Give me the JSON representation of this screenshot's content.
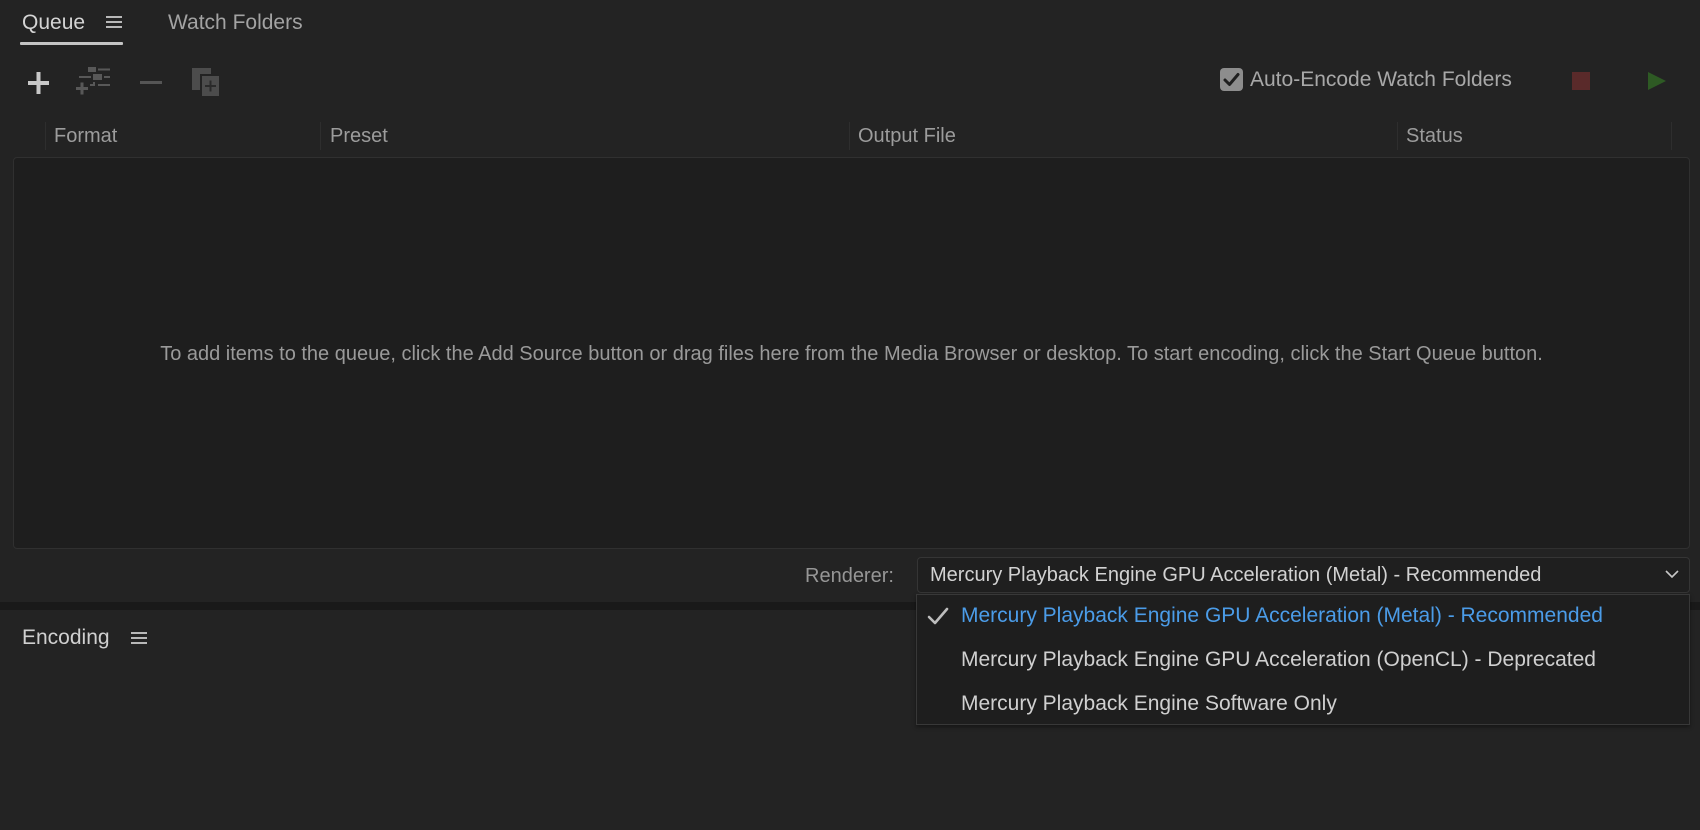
{
  "tabs": [
    {
      "label": "Queue",
      "active": true
    },
    {
      "label": "Watch Folders",
      "active": false
    }
  ],
  "toolbar": {
    "add_source_icon": "plus-icon",
    "add_output_icon": "add-output-icon",
    "remove_icon": "minus-icon",
    "duplicate_icon": "duplicate-icon",
    "auto_encode_label": "Auto-Encode Watch Folders",
    "auto_encode_checked": true,
    "stop_queue_icon": "stop-icon",
    "start_queue_icon": "play-icon",
    "colors": {
      "stop": "#5a2a2a",
      "start": "#2e5a24"
    }
  },
  "columns": [
    "Format",
    "Preset",
    "Output File",
    "Status"
  ],
  "queue": {
    "empty_hint": "To add items to the queue, click the Add Source button or drag files here from the Media Browser or desktop.  To start encoding, click the Start Queue button.",
    "rows": []
  },
  "renderer": {
    "label": "Renderer:",
    "selected": "Mercury Playback Engine GPU Acceleration (Metal) - Recommended",
    "options": [
      {
        "label": "Mercury Playback Engine GPU Acceleration (Metal) - Recommended",
        "selected": true
      },
      {
        "label": "Mercury Playback Engine GPU Acceleration (OpenCL) - Deprecated",
        "selected": false
      },
      {
        "label": "Mercury Playback Engine Software Only",
        "selected": false
      }
    ],
    "accent_color": "#4b9ce8"
  },
  "encoding_panel": {
    "title": "Encoding"
  }
}
